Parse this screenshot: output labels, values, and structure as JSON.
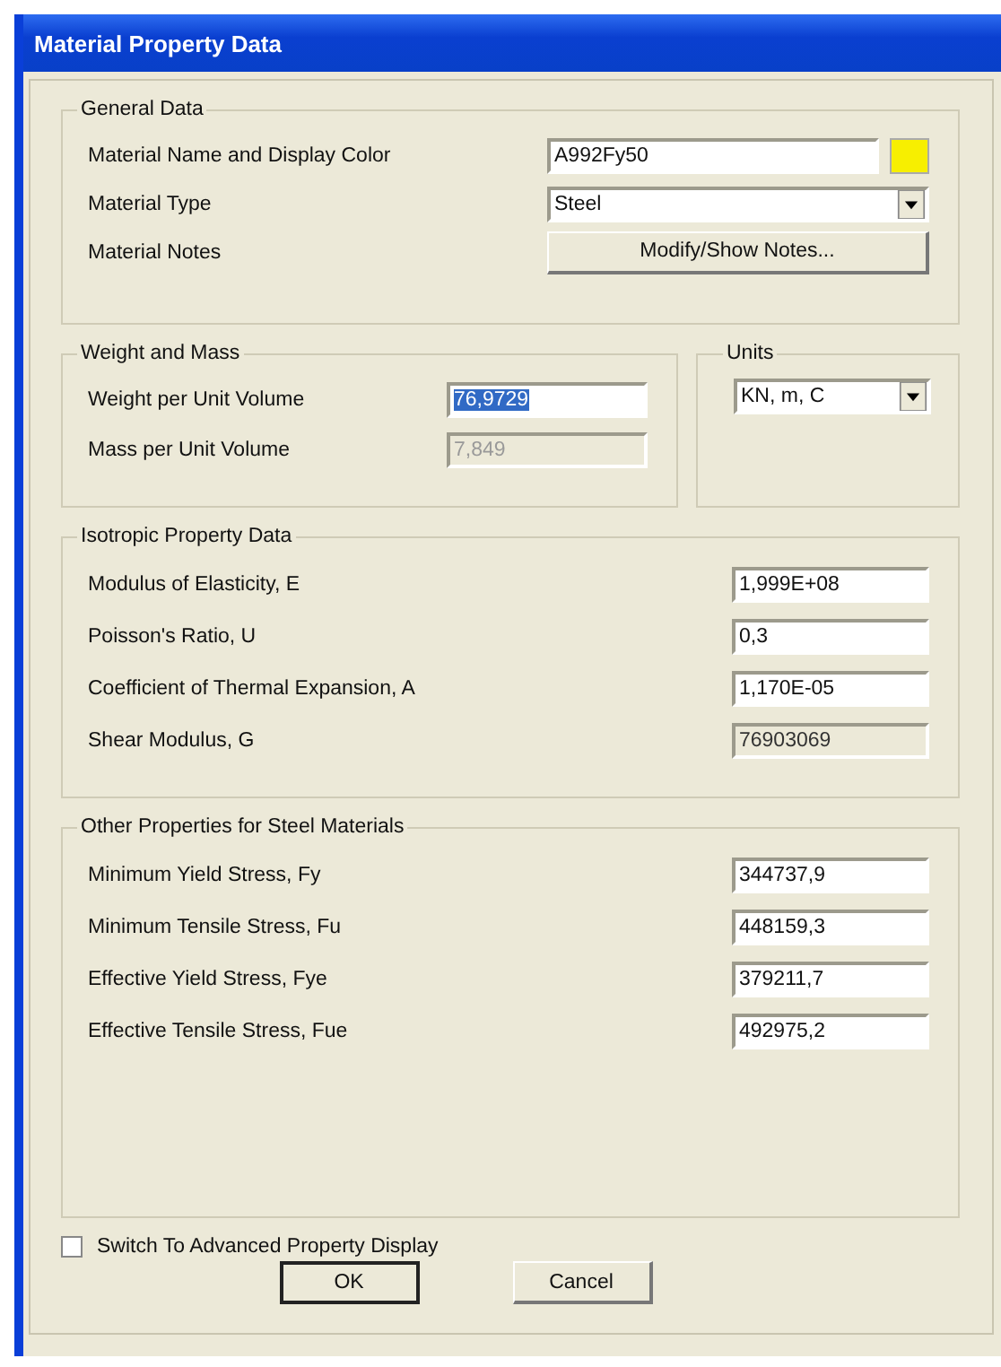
{
  "window": {
    "title": "Material Property Data"
  },
  "general_data": {
    "title": "General Data",
    "rows": [
      {
        "kind": "text_color",
        "label": "Material Name and Display Color",
        "value": "A992Fy50",
        "color": "#f7ef00"
      },
      {
        "kind": "dropdown",
        "label": "Material Type",
        "value": "Steel"
      },
      {
        "kind": "button",
        "label": "Material Notes",
        "value": "Modify/Show Notes..."
      }
    ]
  },
  "weight_and_mass": {
    "title": "Weight and Mass",
    "rows": [
      {
        "label": "Weight per Unit Volume",
        "value": "76,9729",
        "selected": true,
        "disabled": false
      },
      {
        "label": "Mass per Unit Volume",
        "value": "7,849",
        "selected": false,
        "disabled": true
      }
    ]
  },
  "units": {
    "title": "Units",
    "value": "KN, m, C"
  },
  "isotropic_property_data": {
    "title": "Isotropic Property Data",
    "rows": [
      {
        "label": "Modulus of Elasticity,  E",
        "value": "1,999E+08",
        "disabled": false
      },
      {
        "label": "Poisson's Ratio,  U",
        "value": "0,3",
        "disabled": false
      },
      {
        "label": "Coefficient of Thermal Expansion,  A",
        "value": "1,170E-05",
        "disabled": false
      },
      {
        "label": "Shear Modulus,  G",
        "value": "76903069",
        "disabled": true
      }
    ]
  },
  "steel_properties": {
    "title": "Other Properties for Steel Materials",
    "rows": [
      {
        "label": "Minimum Yield Stress, Fy",
        "value": "344737,9",
        "disabled": false
      },
      {
        "label": "Minimum Tensile Stress, Fu",
        "value": "448159,3",
        "disabled": false
      },
      {
        "label": "Effective Yield Stress, Fye",
        "value": "379211,7",
        "disabled": false
      },
      {
        "label": "Effective Tensile Stress, Fue",
        "value": "492975,2",
        "disabled": false
      }
    ]
  },
  "advanced_display": {
    "label": "Switch To Advanced Property Display",
    "checked": false
  },
  "buttons": [
    {
      "label": "OK",
      "default": true
    },
    {
      "label": "Cancel",
      "default": false
    }
  ]
}
